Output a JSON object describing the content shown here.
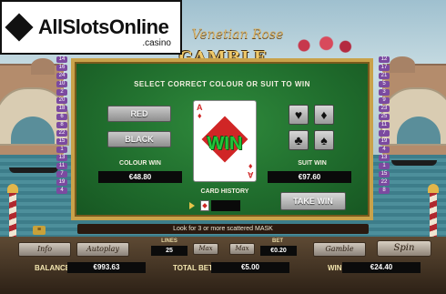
{
  "logo": {
    "text": "AllSlotsOnline",
    "sub": ".casino"
  },
  "title": {
    "script": "Venetian Rose",
    "main": "GAMBLE FEATURE"
  },
  "gamble": {
    "instruction": "SELECT CORRECT COLOUR OR SUIT TO WIN",
    "red_label": "RED",
    "black_label": "BLACK",
    "colour_win_label": "COLOUR WIN",
    "colour_win_value": "€48.80",
    "suit_win_label": "SUIT WIN",
    "suit_win_value": "€97.60",
    "card_rank": "A",
    "card_suit_symbol": "♦",
    "win_text": "WIN",
    "card_history_label": "CARD HISTORY",
    "take_win_label": "TAKE WIN",
    "suits": [
      {
        "name": "hearts",
        "symbol": "♥"
      },
      {
        "name": "diamonds",
        "symbol": "♦"
      },
      {
        "name": "clubs",
        "symbol": "♣"
      },
      {
        "name": "spades",
        "symbol": "♠"
      }
    ]
  },
  "message": "Look for 3 or more scattered MASK",
  "menu_mini": "≡",
  "controls": {
    "info": "Info",
    "autoplay": "Autoplay",
    "lines_label": "LINES",
    "lines_value": "25",
    "max1": "Max",
    "max2": "Max",
    "bet_label": "BET",
    "bet_value": "€0.20",
    "gamble": "Gamble",
    "spin": "Spin",
    "balance_label": "BALANCE",
    "balance_value": "€993.63",
    "total_bet_label": "TOTAL BET",
    "total_bet_value": "€5.00",
    "win_label": "WIN",
    "win_value": "€24.40"
  },
  "strip_left": [
    "14",
    "16",
    "24",
    "10",
    "2",
    "20",
    "18",
    "6",
    "8",
    "22",
    "15",
    "1",
    "13",
    "11",
    "7",
    "19",
    "4"
  ],
  "strip_right": [
    "12",
    "17",
    "21",
    "5",
    "3",
    "9",
    "23",
    "25",
    "11",
    "7",
    "19",
    "4",
    "13",
    "1",
    "15",
    "22",
    "8"
  ],
  "colors": {
    "felt": "#1f6b2c",
    "gold": "#c9a24a",
    "win_green": "#22c73a",
    "red": "#d02626"
  }
}
